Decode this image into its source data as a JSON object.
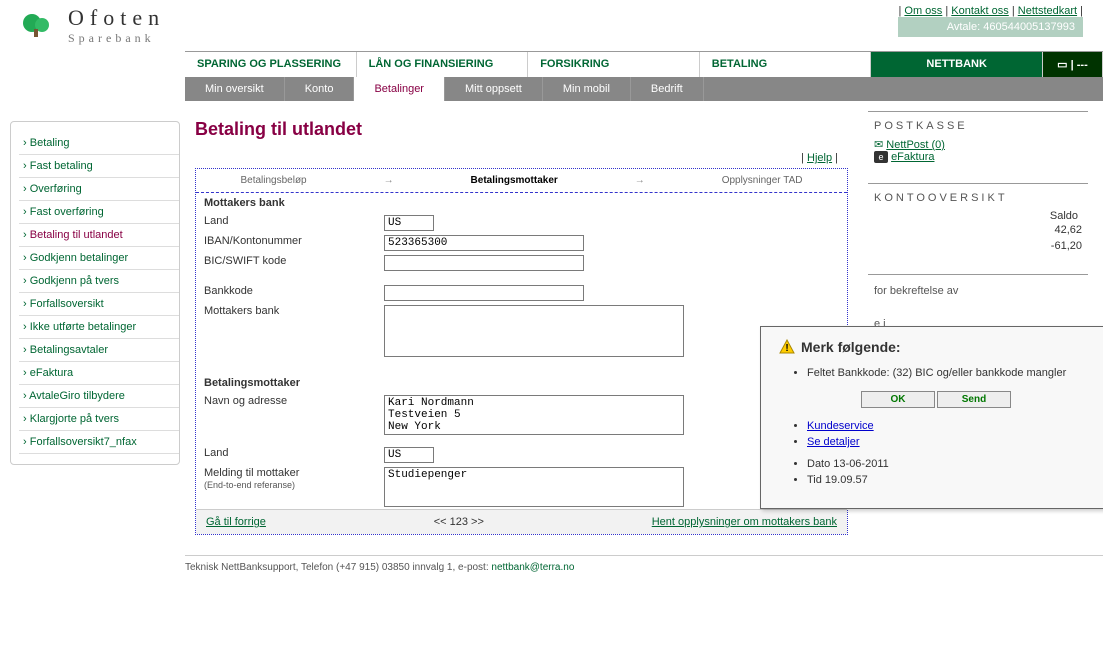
{
  "brand": {
    "name": "Ofoten",
    "sub": "Sparebank"
  },
  "header_links": [
    "Om oss",
    "Kontakt oss",
    "Nettstedkart"
  ],
  "header_info": {
    "avtale_label": "Avtale:",
    "avtale": "460544005137993"
  },
  "main_nav": [
    "SPARING OG PLASSERING",
    "LÅN OG FINANSIERING",
    "FORSIKRING",
    "BETALING",
    "NETTBANK"
  ],
  "sub_nav": [
    "Min oversikt",
    "Konto",
    "Betalinger",
    "Mitt oppsett",
    "Min mobil",
    "Bedrift"
  ],
  "sub_nav_active": 2,
  "sidebar": [
    "Betaling",
    "Fast betaling",
    "Overføring",
    "Fast overføring",
    "Betaling til utlandet",
    "Godkjenn betalinger",
    "Godkjenn på tvers",
    "Forfallsoversikt",
    "Ikke utførte betalinger",
    "Betalingsavtaler",
    "eFaktura",
    "AvtaleGiro tilbydere",
    "Klargjorte på tvers",
    "Forfallsoversikt7_nfax"
  ],
  "sidebar_active": 4,
  "page_title": "Betaling til utlandet",
  "hjelp": "Hjelp",
  "steps": [
    "Betalingsbeløp",
    "Betalingsmottaker",
    "Opplysninger TAD"
  ],
  "steps_active": 1,
  "form": {
    "section1": "Mottakers bank",
    "land_label": "Land",
    "land": "US",
    "iban_label": "IBAN/Kontonummer",
    "iban": "523365300",
    "bic_label": "BIC/SWIFT kode",
    "bic": "",
    "bankkode_label": "Bankkode",
    "bankkode": "",
    "mottakers_bank_label": "Mottakers bank",
    "mottakers_bank": "",
    "section2": "Betalingsmottaker",
    "navn_label": "Navn og adresse",
    "navn": "Kari Nordmann\nTestveien 5\nNew York",
    "land2_label": "Land",
    "land2": "US",
    "melding_label": "Melding til mottaker",
    "melding_sub": "(End-to-end referanse)",
    "melding": "Studiepenger"
  },
  "form_footer": {
    "prev": "Gå til forrige",
    "pager": "<< 123 >>",
    "next": "Hent opplysninger om mottakers bank"
  },
  "postkasse": {
    "title": "POSTKASSE",
    "nettpost": "NettPost (0)",
    "efaktura": "eFaktura"
  },
  "konto": {
    "title": "KONTOOVERSIKT",
    "head": "Saldo",
    "rows": [
      {
        "val": "42,62"
      },
      {
        "val": "-61,20"
      }
    ]
  },
  "info_text": "for bekreftelse av\n\ne i\nfor å sikre en\nføring. Alternativt kan det overføres EUR til land i Europa og USD til resten av verden.",
  "modal": {
    "title": "Merk følgende:",
    "items1": [
      "Feltet Bankkode: (32) BIC og/eller bankkode mangler"
    ],
    "ok": "OK",
    "send": "Send",
    "links": [
      "Kundeservice",
      "Se detaljer"
    ],
    "items2": [
      "Dato 13-06-2011",
      "Tid  19.09.57"
    ]
  },
  "footer": {
    "text": "Teknisk NettBanksupport, Telefon (+47 915) 03850 innvalg 1, e-post: ",
    "mail": "nettbank@terra.no"
  }
}
